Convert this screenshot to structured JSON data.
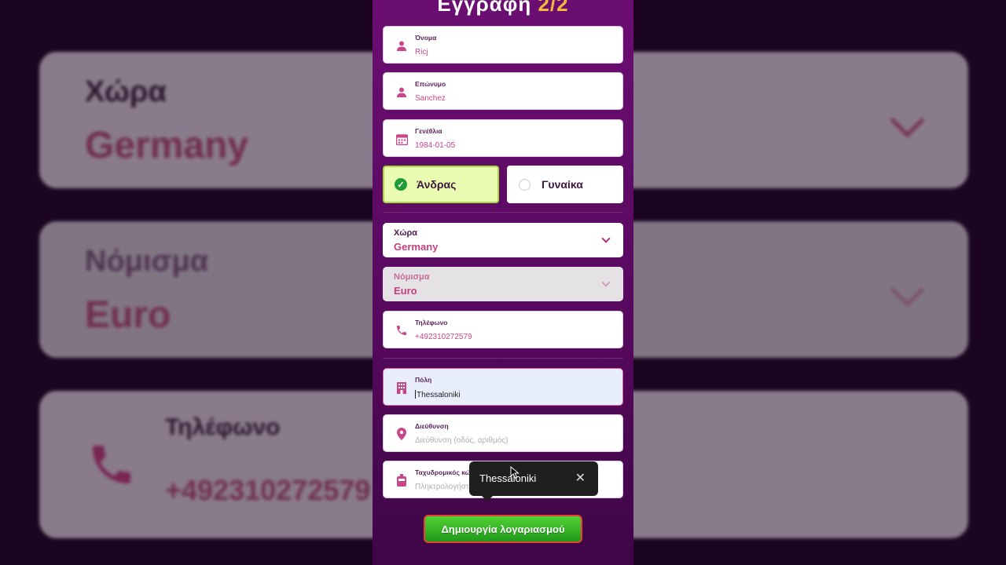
{
  "header": {
    "title": "Εγγραφή",
    "step": "2/2"
  },
  "form": {
    "first_name": {
      "label": "Όνομα",
      "value": "Ricj"
    },
    "last_name": {
      "label": "Επώνυμο",
      "value": "Sanchez"
    },
    "birthdate": {
      "label": "Γενέθλια",
      "value": "1984-01-05"
    },
    "gender": {
      "male": "Άνδρας",
      "female": "Γυναίκα",
      "selected": "male"
    },
    "country": {
      "label": "Χώρα",
      "value": "Germany"
    },
    "currency": {
      "label": "Νόμισμα",
      "value": "Euro"
    },
    "phone": {
      "label": "Τηλέφωνο",
      "value": "+492310272579"
    },
    "city": {
      "label": "Πόλη",
      "value": "Thessaloniki"
    },
    "address": {
      "label": "Διεύθυνση",
      "placeholder": "Διεύθυνση (οδός, αριθμός)"
    },
    "postal": {
      "label": "Ταχυδρομικός κώδι",
      "placeholder": "Πληκτρολογήστ"
    }
  },
  "autocomplete": {
    "suggestion": "Thessaloniki",
    "close": "✕"
  },
  "submit": {
    "label": "Δημιουργία λογαριασμού"
  },
  "colors": {
    "accent": "#c9468b",
    "bg": "#6b0e72",
    "cta": "#3cbf2a"
  }
}
